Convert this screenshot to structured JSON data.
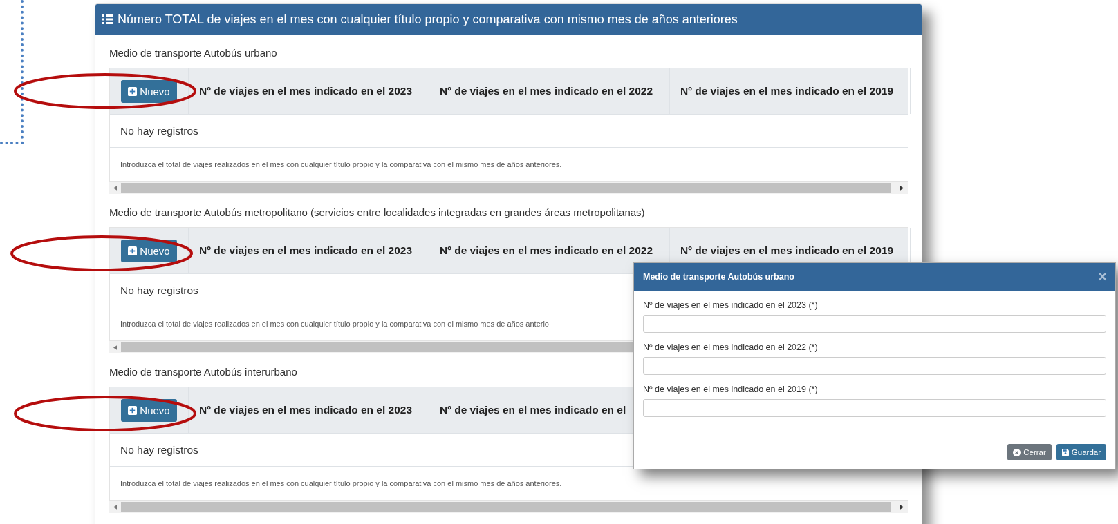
{
  "panel": {
    "title": "Número TOTAL de viajes en el mes con cualquier título propio y comparativa con mismo mes de años anteriores"
  },
  "sections": [
    {
      "label": "Medio de transporte Autobús urbano",
      "new_button": "Nuevo",
      "columns": [
        "Nº de viajes en el mes indicado en el 2023",
        "Nº de viajes en el mes indicado en el 2022",
        "Nº de viajes en el mes indicado en el 2019"
      ],
      "empty_text": "No hay registros",
      "note": "Introduzca el total de viajes realizados en el mes con cualquier título propio y la comparativa con el mismo mes de años anteriores."
    },
    {
      "label": "Medio de transporte Autobús metropolitano (servicios entre localidades integradas en grandes áreas metropolitanas)",
      "new_button": "Nuevo",
      "columns": [
        "Nº de viajes en el mes indicado en el 2023",
        "Nº de viajes en el mes indicado en el 2022",
        "Nº de viajes en el mes indicado en el 2019"
      ],
      "empty_text": "No hay registros",
      "note": "Introduzca el total de viajes realizados en el mes con cualquier título propio y la comparativa con el mismo mes de años anterio"
    },
    {
      "label": "Medio de transporte Autobús interurbano",
      "new_button": "Nuevo",
      "columns": [
        "Nº de viajes en el mes indicado en el 2023",
        "Nº de viajes en el mes indicado en el"
      ],
      "empty_text": "No hay registros",
      "note": "Introduzca el total de viajes realizados en el mes con cualquier título propio y la comparativa con el mismo mes de años anteriores."
    }
  ],
  "modal": {
    "title": "Medio de transporte Autobús urbano",
    "close": "×",
    "fields": [
      {
        "label": "Nº de viajes en el mes indicado en el 2023 (*)"
      },
      {
        "label": "Nº de viajes en el mes indicado en el 2022 (*)"
      },
      {
        "label": "Nº de viajes en el mes indicado en el 2019 (*)"
      }
    ],
    "buttons": [
      {
        "kind": "close",
        "label": "Cerrar"
      },
      {
        "kind": "save",
        "label": "Guardar"
      }
    ]
  }
}
